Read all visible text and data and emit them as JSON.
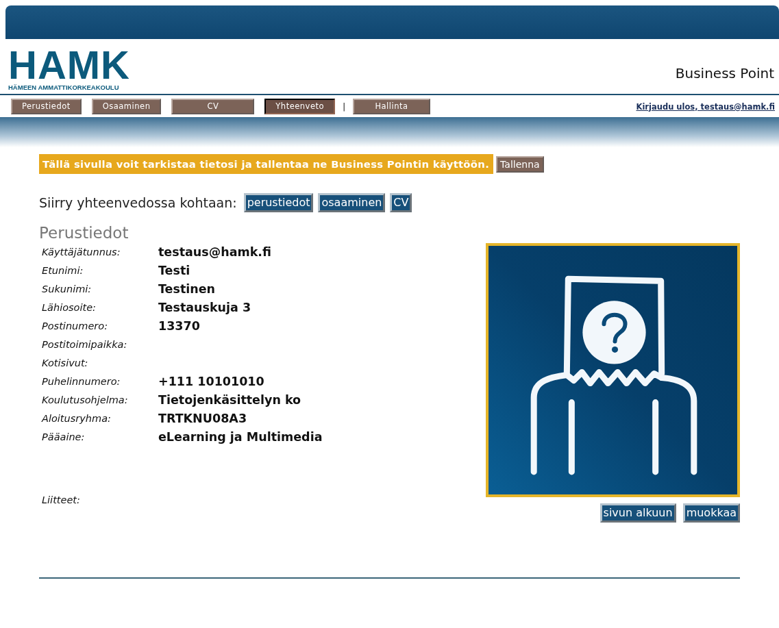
{
  "logo": {
    "name": "HAMK",
    "subtitle": "HÄMEEN AMMATTIKORKEAKOULU"
  },
  "site_title": "Business Point",
  "tabs": [
    {
      "label": "Perustiedot",
      "selected": false
    },
    {
      "label": "Osaaminen",
      "selected": false
    },
    {
      "label": "CV",
      "selected": false
    },
    {
      "label": "Yhteenveto",
      "selected": true
    },
    {
      "kind": "separator",
      "label": "|"
    },
    {
      "label": "Hallinta",
      "selected": false
    }
  ],
  "logout_link": "Kirjaudu ulos, testaus@hamk.fi",
  "notice": {
    "text": "Tällä sivulla voit tarkistaa tietosi ja tallentaa ne Business Pointin käyttöön.",
    "button": "Tallenna"
  },
  "jump": {
    "label": "Siirry yhteenvedossa kohtaan:",
    "buttons": [
      "perustiedot",
      "osaaminen",
      "CV"
    ]
  },
  "section": {
    "title": "Perustiedot",
    "fields": [
      {
        "label": "Käyttäjätunnus:",
        "value": "testaus@hamk.fi"
      },
      {
        "label": "Etunimi:",
        "value": "Testi"
      },
      {
        "label": "Sukunimi:",
        "value": "Testinen"
      },
      {
        "label": "Lähiosoite:",
        "value": "Testauskuja 3"
      },
      {
        "label": "Postinumero:",
        "value": "13370"
      },
      {
        "label": "Postitoimipaikka:"
      },
      {
        "label": "Kotisivut:"
      },
      {
        "label": "Puhelinnumero:",
        "value": "+111 10101010"
      },
      {
        "label": "Koulutusohjelma:",
        "value": "Tietojenkäsittelyn ko"
      },
      {
        "label": "Aloitusryhma:",
        "value": "TRTKNU08A3"
      },
      {
        "label": "Pääaine:",
        "value": "eLearning ja Multimedia"
      }
    ],
    "attachments_label": "Liitteet:",
    "buttons": [
      "sivun alkuun",
      "muokkaa"
    ]
  }
}
